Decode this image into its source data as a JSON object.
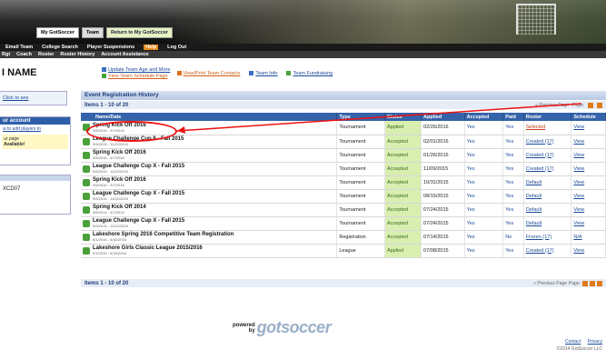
{
  "header": {
    "tabs": [
      "My GotSoccer",
      "Team",
      "Return to My GotSoccer"
    ]
  },
  "nav1": [
    "Email Team",
    "College Search",
    "Player Suspensions",
    "Help",
    "Log Out"
  ],
  "nav2": [
    "Rgt",
    "Coach",
    "Roster",
    "Roster History",
    "Account Assistance"
  ],
  "page": {
    "title": "I NAME"
  },
  "links": {
    "update_team": "Update Team Age and More",
    "view_schedule": "View Team Schedule Page",
    "view_print": "View/Print Team Contacts",
    "team_info": "Team Info",
    "fundraising": "Team Fundraising"
  },
  "sidebar": {
    "box1_link": "Click to see",
    "account_header": "ur account",
    "account_link": "w to add players to",
    "note1": "ur page",
    "note2": "Available!",
    "code": "XCD07"
  },
  "section": {
    "title": "Event Registration History",
    "items_label": "Items 1 - 10 of 20",
    "prev_page": "« Previous Page",
    "page_label": "Page:",
    "pages": [
      "1",
      "2",
      "3"
    ]
  },
  "table": {
    "headers": [
      "Name/Date",
      "Type",
      "Status",
      "Applied",
      "Accepted",
      "Paid",
      "Roster",
      "Schedule"
    ],
    "rows": [
      {
        "name": "Spring Kick Off 2016",
        "dates": "3/5/2016 - 3/7/2016",
        "type": "Tournament",
        "status": "Applied",
        "applied": "02/26/2016",
        "accepted": "Yes",
        "paid": "Yes",
        "roster": "Selected",
        "roster_red": true,
        "schedule": "View"
      },
      {
        "name": "League Challenge Cup II - Fall 2015",
        "dates": "9/5/2015 - 11/22/2015",
        "type": "Tournament",
        "status": "Accepted",
        "applied": "02/01/2016",
        "accepted": "Yes",
        "paid": "Yes",
        "roster": "Created (17)",
        "roster_red": false,
        "schedule": "View"
      },
      {
        "name": "Spring Kick Off 2016",
        "dates": "3/5/2016 - 3/7/2016",
        "type": "Tournament",
        "status": "Accepted",
        "applied": "01/26/2016",
        "accepted": "Yes",
        "paid": "Yes",
        "roster": "Created (17)",
        "roster_red": false,
        "schedule": "View"
      },
      {
        "name": "League Challenge Cup X - Fall 2015",
        "dates": "9/5/2015 - 11/22/2015",
        "type": "Tournament",
        "status": "Accepted",
        "applied": "11/09/2015",
        "accepted": "Yes",
        "paid": "Yes",
        "roster": "Created (17)",
        "roster_red": false,
        "schedule": "View"
      },
      {
        "name": "Spring Kick Off 2016",
        "dates": "3/5/2016 - 3/7/2016",
        "type": "Tournament",
        "status": "Accepted",
        "applied": "10/31/2015",
        "accepted": "Yes",
        "paid": "Yes",
        "roster": "Default",
        "roster_red": false,
        "schedule": "View"
      },
      {
        "name": "League Challenge Cup X - Fall 2015",
        "dates": "9/5/2015 - 11/22/2015",
        "type": "Tournament",
        "status": "Accepted",
        "applied": "08/15/2015",
        "accepted": "Yes",
        "paid": "Yes",
        "roster": "Default",
        "roster_red": false,
        "schedule": "View"
      },
      {
        "name": "Spring Kick Off 2014",
        "dates": "3/5/2014 - 3/7/2014",
        "type": "Tournament",
        "status": "Accepted",
        "applied": "07/24/2015",
        "accepted": "Yes",
        "paid": "Yes",
        "roster": "Default",
        "roster_red": false,
        "schedule": "View"
      },
      {
        "name": "League Challenge Cup X - Fall 2015",
        "dates": "9/5/2015 - 11/22/2015",
        "type": "Tournament",
        "status": "Accepted",
        "applied": "07/24/2015",
        "accepted": "Yes",
        "paid": "Yes",
        "roster": "Default",
        "roster_red": false,
        "schedule": "View"
      },
      {
        "name": "Lakeshore Spring 2016 Competitive Team Registration",
        "dates": "6/1/2016 - 6/30/2016",
        "type": "Registration",
        "status": "Accepted",
        "applied": "07/14/2015",
        "accepted": "Yes",
        "paid": "No",
        "roster": "Frozen (17)",
        "roster_red": false,
        "schedule": "N/A"
      },
      {
        "name": "Lakeshore Girls Classic League 2015/2016",
        "dates": "9/1/2015 - 6/30/2016",
        "type": "League",
        "status": "Applied",
        "applied": "07/08/2015",
        "accepted": "Yes",
        "paid": "Yes",
        "roster": "Created (17)",
        "roster_red": false,
        "schedule": "View"
      }
    ]
  },
  "footer": {
    "powered_top": "powered",
    "powered_bottom": "by",
    "logo": "gotsoccer",
    "contact": "Contact",
    "privacy": "Privacy",
    "copyright": "©2014 GotSoccer LLC"
  },
  "colors": {
    "header_blue": "#3563a9",
    "status_green": "#d9efb0",
    "annotation_red": "#e11111",
    "accent_orange": "#e07a1a"
  }
}
